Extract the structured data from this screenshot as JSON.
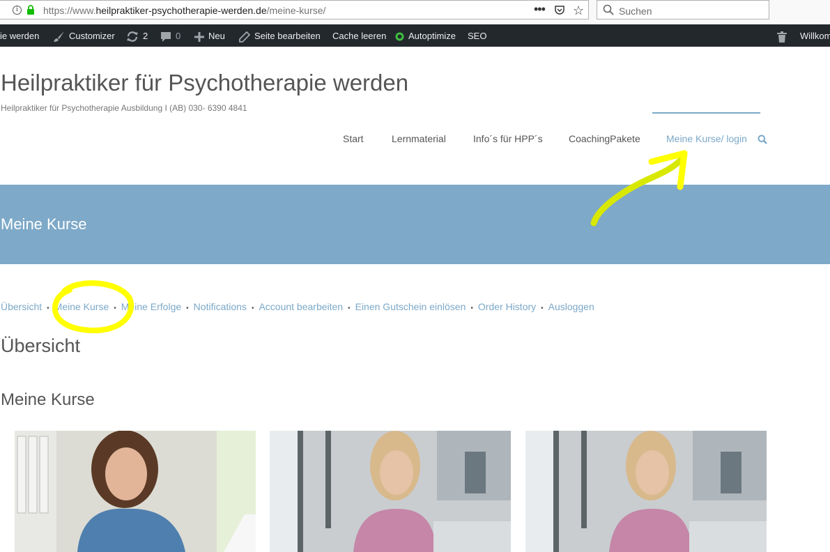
{
  "browser": {
    "url_host_part": "https://www.",
    "url_domain": "heilpraktiker-psychotherapie-werden.de",
    "url_path": "/meine-kurse/",
    "more_glyph": "•••",
    "search_placeholder": "Suchen"
  },
  "adminbar": {
    "site_fragment": "ie werden",
    "customizer": "Customizer",
    "updates_count": "2",
    "comments_count": "0",
    "new": "Neu",
    "edit_page": "Seite bearbeiten",
    "clear_cache": "Cache leeren",
    "autoptimize": "Autoptimize",
    "seo": "SEO",
    "welcome": "Willkom"
  },
  "site": {
    "title": "Heilpraktiker für Psychotherapie werden",
    "tagline": "Heilpraktiker für Psychotherapie Ausbildung I (AB) 030- 6390 4841"
  },
  "nav": {
    "items": [
      "Start",
      "Lernmaterial",
      "Info´s für HPP´s",
      "CoachingPakete",
      "Meine Kurse/ login"
    ],
    "active_index": 4
  },
  "banner": {
    "title": "Meine Kurse"
  },
  "account_nav": {
    "items": [
      "Übersicht",
      "Meine Kurse",
      "Meine Erfolge",
      "Notifications",
      "Account bearbeiten",
      "Einen Gutschein einlösen",
      "Order History",
      "Ausloggen"
    ],
    "separator": "•"
  },
  "content": {
    "overview_heading": "Übersicht",
    "courses_heading": "Meine Kurse"
  },
  "colors": {
    "accent": "#7ba8c8",
    "banner": "#7ea9c8",
    "adminbar": "#23282d",
    "annotation_yellow": "#ffff00"
  }
}
